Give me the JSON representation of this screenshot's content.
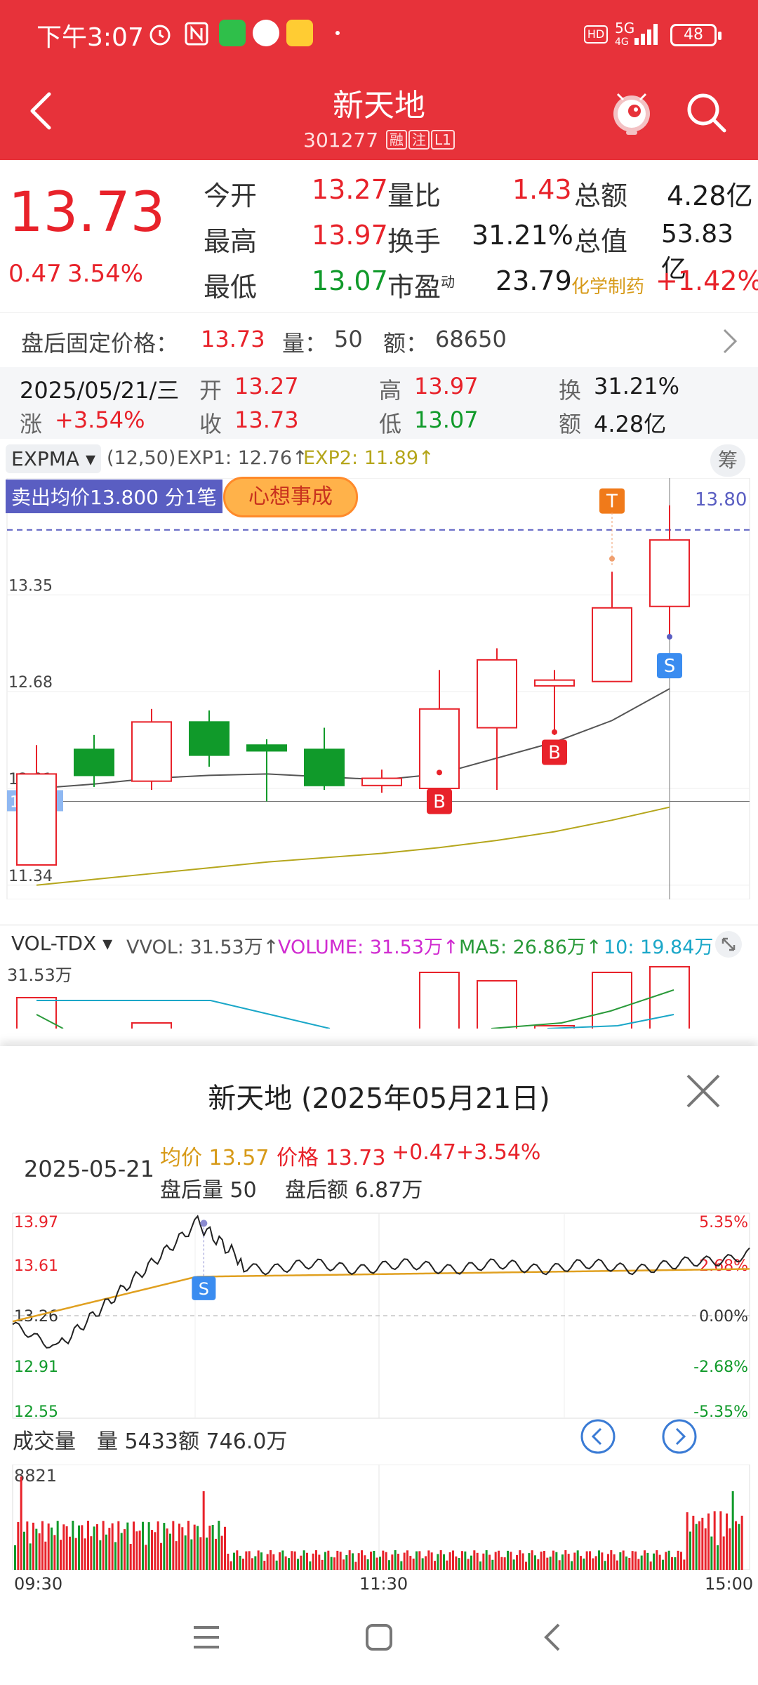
{
  "status": {
    "time": "下午3:07",
    "network": "5G",
    "signal_sub": "4G",
    "battery": "48",
    "hd": "HD"
  },
  "header": {
    "title": "新天地",
    "code": "301277",
    "tags": [
      "融",
      "注",
      "L1"
    ],
    "icons": [
      "back-icon",
      "robot-icon",
      "search-icon"
    ]
  },
  "quote": {
    "price": "13.73",
    "change": "0.47",
    "change_pct": "3.54%",
    "fields": [
      {
        "label": "今开",
        "value": "13.27",
        "label2": "量比",
        "value2": "1.43",
        "label3": "总额",
        "value3": "4.28亿"
      },
      {
        "label": "最高",
        "value": "13.97",
        "label2": "换手",
        "value2": "31.21%",
        "label3": "总值",
        "value3": "53.83亿"
      },
      {
        "label": "最低",
        "value": "13.07",
        "label2": "市盈",
        "label2_sup": "动",
        "value2": "23.79",
        "label3": "化学制药",
        "value3": "+1.42%"
      }
    ]
  },
  "after_hours": {
    "label": "盘后固定价格：",
    "price": "13.73",
    "vol_label": "量：",
    "vol": "50",
    "amt_label": "额：",
    "amt": "68650"
  },
  "info_band": {
    "date": "2025/05/21/三",
    "open_label": "开",
    "open": "13.27",
    "high_label": "高",
    "high": "13.97",
    "turn_label": "换",
    "turn": "31.21%",
    "chg_label": "涨",
    "chg": "+3.54%",
    "close_label": "收",
    "close": "13.73",
    "low_label": "低",
    "low": "13.07",
    "amt_label": "额",
    "amt": "4.28亿"
  },
  "kchart": {
    "indicator": "EXPMA",
    "params": "(12,50)",
    "exp1": "EXP1: 12.76↑",
    "exp2": "EXP2: 11.89↑",
    "chip_button": "筹",
    "sell_note": "卖出均价13.800 分1笔",
    "sticker": "心想事成",
    "price_line": "13.80",
    "y_labels": [
      "13.35",
      "12.68",
      "12.01",
      "11.92",
      "11.34"
    ],
    "markers": [
      "T",
      "S",
      "B",
      "B"
    ],
    "candles": [
      {
        "o": 11.48,
        "c": 12.11,
        "h": 12.31,
        "l": 11.48,
        "up": true
      },
      {
        "o": 12.28,
        "c": 12.1,
        "h": 12.38,
        "l": 12.02,
        "up": false
      },
      {
        "o": 12.06,
        "c": 12.47,
        "h": 12.56,
        "l": 12.0,
        "up": true
      },
      {
        "o": 12.47,
        "c": 12.24,
        "h": 12.55,
        "l": 12.16,
        "up": false
      },
      {
        "o": 12.31,
        "c": 12.27,
        "h": 12.35,
        "l": 11.92,
        "up": false
      },
      {
        "o": 12.28,
        "c": 12.03,
        "h": 12.43,
        "l": 12.0,
        "up": false
      },
      {
        "o": 12.03,
        "c": 12.08,
        "h": 12.14,
        "l": 11.98,
        "up": true
      },
      {
        "o": 12.01,
        "c": 12.56,
        "h": 12.83,
        "l": 11.86,
        "up": true
      },
      {
        "o": 12.43,
        "c": 12.9,
        "h": 12.98,
        "l": 12.0,
        "up": true
      },
      {
        "o": 12.76,
        "c": 12.72,
        "h": 12.83,
        "l": 12.38,
        "up": true
      },
      {
        "o": 12.75,
        "c": 13.26,
        "h": 13.51,
        "l": 12.75,
        "up": true
      },
      {
        "o": 13.27,
        "c": 13.73,
        "h": 13.97,
        "l": 13.07,
        "up": true
      }
    ],
    "exp1_line": [
      12.01,
      12.04,
      12.08,
      12.1,
      12.11,
      12.09,
      12.07,
      12.11,
      12.22,
      12.33,
      12.48,
      12.7
    ],
    "exp2_line": [
      11.34,
      11.38,
      11.42,
      11.46,
      11.5,
      11.53,
      11.56,
      11.6,
      11.65,
      11.71,
      11.79,
      11.88
    ],
    "vol_indicator": "VOL-TDX",
    "vvol": "VVOL: 31.53万↑",
    "volume": "VOLUME: 31.53万↑",
    "ma5": "MA5: 26.86万↑",
    "ma10": "10: 19.84万↑",
    "vol_max": "31.53万"
  },
  "sheet": {
    "title": "新天地 (2025年05月21日)",
    "date": "2025-05-21",
    "avg_label": "均价",
    "avg": "13.57",
    "price_label": "价格",
    "price": "13.73",
    "chg": "+0.47",
    "pct": "+3.54%",
    "ah_vol_label": "盘后量",
    "ah_vol": "50",
    "ah_amt_label": "盘后额",
    "ah_amt": "6.87万",
    "y_left": [
      "13.97",
      "13.61",
      "13.26",
      "12.91",
      "12.55"
    ],
    "y_right": [
      "5.35%",
      "2.68%",
      "0.00%",
      "-2.68%",
      "-5.35%"
    ],
    "vol_title": "成交量",
    "vol_label": "量",
    "vol": "5433",
    "amt_label": "额",
    "amt": "746.0万",
    "vol_max": "8821",
    "x_labels": [
      "09:30",
      "11:30",
      "15:00"
    ],
    "marker": "S"
  },
  "nav": {
    "icons": [
      "menu-icon",
      "home-icon",
      "back-nav-icon"
    ]
  },
  "colors": {
    "red": "#e8222a",
    "green": "#109a2a",
    "header_bg": "#e7323a",
    "exp1": "#555555",
    "exp2": "#b5a61c",
    "avg_line": "#e0a020",
    "magenta": "#d02ad0",
    "cyan": "#1aa7c8"
  }
}
